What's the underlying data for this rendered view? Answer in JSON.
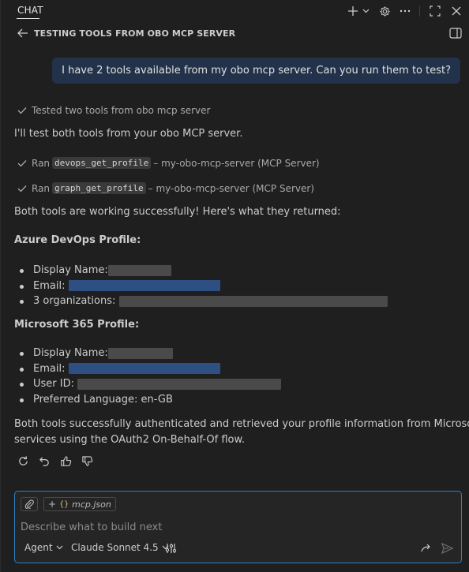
{
  "topbar": {
    "tab_label": "CHAT",
    "icons": [
      "plus-icon",
      "chevron-down-icon",
      "gear-icon",
      "more-icon",
      "maximize-icon",
      "close-icon"
    ]
  },
  "header": {
    "title": "TESTING TOOLS FROM OBO MCP SERVER"
  },
  "user_message": "I have 2 tools available from my obo mcp server. Can you run them to test?",
  "assistant": {
    "thinking_summary": "Tested two tools from obo mcp server",
    "intro": "I'll test both tools from your obo MCP server.",
    "tool_runs": [
      {
        "prefix": "Ran",
        "tool": "devops_get_profile",
        "suffix": "– my-obo-mcp-server (MCP Server)"
      },
      {
        "prefix": "Ran",
        "tool": "graph_get_profile",
        "suffix": "– my-obo-mcp-server (MCP Server)"
      }
    ],
    "result_intro": "Both tools are working successfully! Here's what they returned:",
    "devops": {
      "heading": "Azure DevOps Profile:",
      "items": [
        {
          "label": "Display Name:"
        },
        {
          "label": "Email:"
        },
        {
          "label": "3 organizations:"
        }
      ]
    },
    "m365": {
      "heading": "Microsoft 365 Profile:",
      "items": [
        {
          "label": "Display Name:"
        },
        {
          "label": "Email:"
        },
        {
          "label": "User ID:"
        },
        {
          "label": "Preferred Language: en-GB"
        }
      ]
    },
    "summary_line1": "Both tools successfully authenticated and retrieved your profile information from Microsoft",
    "summary_line2": "services using the OAuth2 On-Behalf-Of flow.",
    "actions": [
      "retry-icon",
      "undo-icon",
      "thumbs-up-icon",
      "thumbs-down-icon"
    ]
  },
  "input": {
    "context_chip": "mcp.json",
    "chip_braces": "{}",
    "placeholder": "Describe what to build next",
    "mode": "Agent",
    "model": "Claude Sonnet 4.5"
  },
  "colors": {
    "background": "#1f1f1f",
    "user_bubble": "#22324a",
    "input_border": "#2a82c6"
  }
}
